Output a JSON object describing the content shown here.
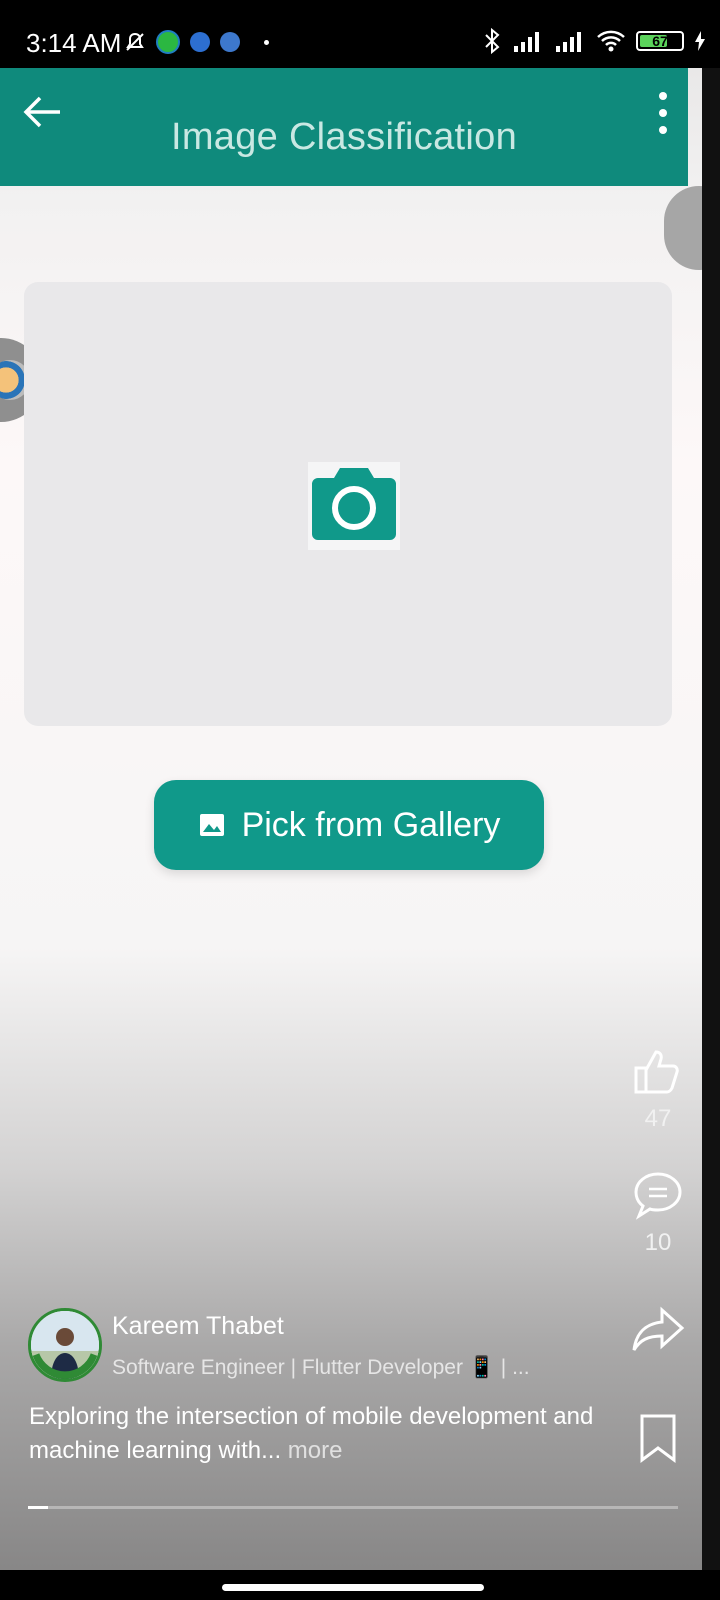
{
  "status_bar": {
    "time": "3:14 AM",
    "battery_level": "67",
    "battery_fraction": 0.67,
    "icons": [
      "mute-notifications-icon",
      "whatsapp-icon",
      "messenger-icon",
      "notification-app-icon",
      "bluetooth-icon",
      "signal-icon",
      "signal-icon",
      "wifi-icon",
      "battery-icon",
      "charging-icon"
    ]
  },
  "app": {
    "title": "Image Classification",
    "gallery_button_label": "Pick from Gallery",
    "accent_color": "#0f8a7c",
    "button_color": "#10998a"
  },
  "actions": {
    "likes": "47",
    "comments": "10"
  },
  "post": {
    "author_name": "Kareem Thabet",
    "author_headline": "Software Engineer | Flutter Developer 📱 | ...",
    "caption": "Exploring the intersection of mobile development and machine learning with...",
    "caption_more": " more",
    "progress_fraction": 0.03
  }
}
